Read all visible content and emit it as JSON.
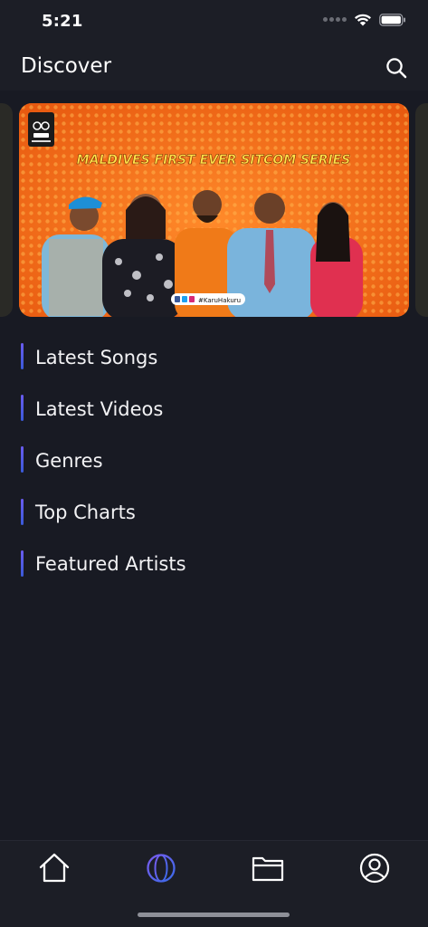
{
  "status_bar": {
    "time": "5:21"
  },
  "header": {
    "title": "Discover",
    "search_icon": "search-icon"
  },
  "banner": {
    "headline": "MALDIVES FIRST EVER SITCOM SERIES",
    "hashtag": "#KaruHakuru"
  },
  "sections": [
    {
      "label": "Latest Songs"
    },
    {
      "label": "Latest Videos"
    },
    {
      "label": "Genres"
    },
    {
      "label": "Top Charts"
    },
    {
      "label": "Featured Artists"
    }
  ],
  "tab_bar": {
    "tabs": [
      {
        "icon": "home-icon",
        "active": false
      },
      {
        "icon": "globe-icon",
        "active": true
      },
      {
        "icon": "folder-icon",
        "active": false
      },
      {
        "icon": "profile-icon",
        "active": false
      }
    ]
  },
  "colors": {
    "background": "#181a23",
    "bar": "#1c1e26",
    "accent": "#5b63f0",
    "banner_orange": "#f06a16",
    "headline_yellow": "#ffe24a"
  }
}
